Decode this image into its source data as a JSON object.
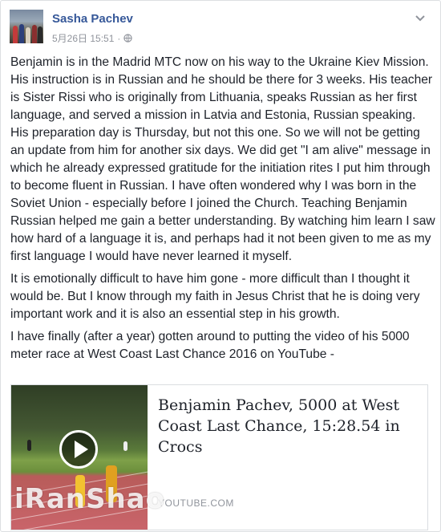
{
  "post": {
    "author": "Sasha Pachev",
    "timestamp": "5月26日 15:51",
    "separator": "·",
    "privacy_icon": "globe-icon",
    "menu_icon": "chevron-down-icon",
    "paragraphs": [
      "Benjamin is in the Madrid MTC now on his way to the Ukraine Kiev Mission. His instruction is in Russian and he should be there for 3 weeks. His teacher is Sister Rissi who is originally from Lithuania, speaks Russian as her first language, and served a mission in Latvia and Estonia, Russian speaking. His preparation day is Thursday, but not this one. So we will not be getting an update from him for another six days. We did get \"I am alive\" message in which he already expressed gratitude for the initiation rites I put him through to become fluent in Russian. I have often wondered why I was born in the Soviet Union - especially before I joined the Church. Teaching Benjamin Russian helped me gain a better understanding. By watching him learn I saw how hard of a language it is, and perhaps had it not been given to me as my first language I would have never learned it myself.",
      "It is emotionally difficult to have him gone - more difficult than I thought it would be. But I know through my faith in Jesus Christ that he is doing very important work and it is also an essential step in his growth.",
      "I have finally (after a year) gotten around to putting the video of his 5000 meter race at West Coast Last Chance 2016 on YouTube -"
    ]
  },
  "link_card": {
    "title": "Benjamin Pachev, 5000 at West Coast Last Chance, 15:28.54 in Crocs",
    "source": "YOUTUBE.COM",
    "play_icon": "play-icon"
  },
  "watermark": {
    "text": "iRanShao"
  }
}
